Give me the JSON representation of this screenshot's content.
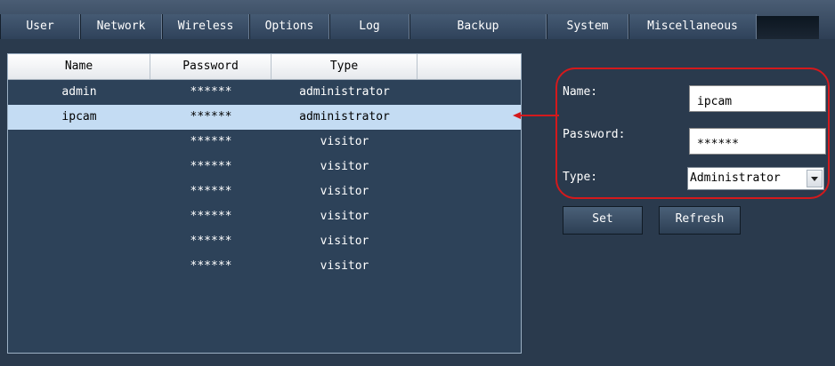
{
  "tabs": [
    "User",
    "Network",
    "Wireless",
    "Options",
    "Log",
    "Backup",
    "System",
    "Miscellaneous"
  ],
  "table": {
    "headers": [
      "Name",
      "Password",
      "Type",
      ""
    ],
    "rows": [
      {
        "name": "admin",
        "password": "******",
        "type": "administrator"
      },
      {
        "name": "ipcam",
        "password": "******",
        "type": "administrator",
        "selected": true
      },
      {
        "name": "",
        "password": "******",
        "type": "visitor"
      },
      {
        "name": "",
        "password": "******",
        "type": "visitor"
      },
      {
        "name": "",
        "password": "******",
        "type": "visitor"
      },
      {
        "name": "",
        "password": "******",
        "type": "visitor"
      },
      {
        "name": "",
        "password": "******",
        "type": "visitor"
      },
      {
        "name": "",
        "password": "******",
        "type": "visitor"
      }
    ]
  },
  "form": {
    "name_label": "Name:",
    "name_value": "ipcam",
    "password_label": "Password:",
    "password_value": "******",
    "type_label": "Type:",
    "type_value": "Administrator"
  },
  "buttons": {
    "set": "Set",
    "refresh": "Refresh"
  },
  "icons": {
    "dropdown": "chevron-down-icon",
    "callout": "arrow-left-icon"
  },
  "colors": {
    "highlight": "#d4191c",
    "selected_row": "#c4dcf3",
    "panel_bg": "#2a3a4d"
  }
}
